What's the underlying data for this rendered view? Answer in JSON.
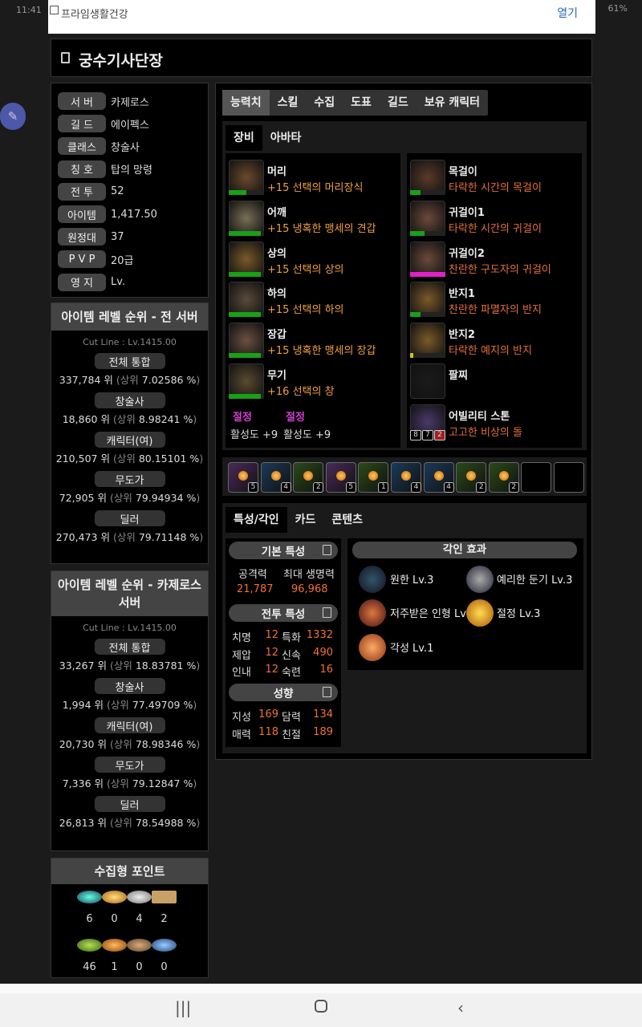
{
  "status": {
    "time": "11:41",
    "battery": "61%"
  },
  "browser": {
    "title": "프라임생활건강",
    "open": "열기"
  },
  "title": "궁수기사단장",
  "info": [
    {
      "k": "서 버",
      "v": "카제로스"
    },
    {
      "k": "길 드",
      "v": "에이펙스"
    },
    {
      "k": "클래스",
      "v": "창술사"
    },
    {
      "k": "칭 호",
      "v": "탑의 망령"
    },
    {
      "k": "전 투",
      "v": "52"
    },
    {
      "k": "아이템",
      "v": "1,417.50"
    },
    {
      "k": "원정대",
      "v": "37"
    },
    {
      "k": "P V P",
      "v": "20급"
    },
    {
      "k": "영 지",
      "v": "Lv."
    }
  ],
  "rank_all": {
    "title": "아이템 레벨 순위 - 전 서버",
    "cut": "Cut Line : Lv.1415.00",
    "items": [
      {
        "label": "전체 통합",
        "rank": "337,784 위",
        "pct": "7.02586 %"
      },
      {
        "label": "창술사",
        "rank": "18,860 위",
        "pct": "8.98241 %"
      },
      {
        "label": "캐릭터(여)",
        "rank": "210,507 위",
        "pct": "80.15101 %"
      },
      {
        "label": "무도가",
        "rank": "72,905 위",
        "pct": "79.94934 %"
      },
      {
        "label": "딜러",
        "rank": "270,473 위",
        "pct": "79.71148 %"
      }
    ]
  },
  "rank_server": {
    "title": "아이템 레벨 순위 - 카제로스 서버",
    "cut": "Cut Line : Lv.1415.00",
    "items": [
      {
        "label": "전체 통합",
        "rank": "33,267 위",
        "pct": "18.83781 %"
      },
      {
        "label": "창술사",
        "rank": "1,994 위",
        "pct": "77.49709 %"
      },
      {
        "label": "캐릭터(여)",
        "rank": "20,730 위",
        "pct": "78.98346 %"
      },
      {
        "label": "무도가",
        "rank": "7,336 위",
        "pct": "79.12847 %"
      },
      {
        "label": "딜러",
        "rank": "26,813 위",
        "pct": "78.54988 %"
      }
    ]
  },
  "rank_prefix": "(상위",
  "rank_suffix": ")",
  "collect": {
    "title": "수집형 포인트",
    "row1": [
      "6",
      "0",
      "4",
      "2"
    ],
    "row2": [
      "46",
      "1",
      "0",
      "0"
    ]
  },
  "tabs": [
    "능력치",
    "스킬",
    "수집",
    "도표",
    "길드",
    "보유 캐릭터"
  ],
  "subtabs": [
    "장비",
    "아바타"
  ],
  "equip_left": [
    {
      "name": "머리",
      "desc": "+15 선택의 머리장식",
      "q": 50
    },
    {
      "name": "어깨",
      "desc": "+15 냉혹한 맹세의 견갑",
      "q": 90
    },
    {
      "name": "상의",
      "desc": "+15 선택의 상의",
      "q": 90
    },
    {
      "name": "하의",
      "desc": "+15 선택의 하의",
      "q": 90
    },
    {
      "name": "장갑",
      "desc": "+15 냉혹한 맹세의 장갑",
      "q": 90
    },
    {
      "name": "무기",
      "desc": "+16 선택의 창",
      "q": 90
    }
  ],
  "equip_right": [
    {
      "name": "목걸이",
      "desc": "타락한 시간의 목걸이",
      "q": 30
    },
    {
      "name": "귀걸이1",
      "desc": "타락한 시간의 귀걸이",
      "q": 40
    },
    {
      "name": "귀걸이2",
      "desc": "찬란한 구도자의 귀걸이",
      "q": 100
    },
    {
      "name": "반지1",
      "desc": "찬란한 파멸자의 반지",
      "q": 30
    },
    {
      "name": "반지2",
      "desc": "타락한 예지의 반지",
      "q": 10
    },
    {
      "name": "팔찌",
      "desc": "",
      "q": 0
    },
    {
      "name": "어빌리티 스톤",
      "desc": "고고한 비상의 돌",
      "q": 0
    }
  ],
  "stone_levels": [
    "8",
    "7",
    "2"
  ],
  "elixir": [
    {
      "label": "절정",
      "sub": "활성도 +9"
    },
    {
      "label": "절정",
      "sub": "활성도 +9"
    }
  ],
  "gems": [
    "5",
    "4",
    "2",
    "5",
    "1",
    "4",
    "4",
    "2",
    "2",
    "",
    ""
  ],
  "lowtabs": [
    "특성/각인",
    "카드",
    "콘텐츠"
  ],
  "basic": {
    "title": "기본 특성",
    "atk_label": "공격력",
    "hp_label": "최대 생명력",
    "atk": "21,787",
    "hp": "96,968"
  },
  "combat": {
    "title": "전투 특성",
    "rows": [
      [
        "치명",
        "12",
        "특화",
        "1332"
      ],
      [
        "제압",
        "12",
        "신속",
        "490"
      ],
      [
        "인내",
        "12",
        "숙련",
        "16"
      ]
    ]
  },
  "tend": {
    "title": "성향",
    "rows": [
      [
        "지성",
        "169",
        "담력",
        "134"
      ],
      [
        "매력",
        "118",
        "친절",
        "189"
      ]
    ]
  },
  "engrave": {
    "title": "각인 효과",
    "items": [
      "원한 Lv.3",
      "예리한 둔기 Lv.3",
      "저주받은 인형 Lv",
      "절정 Lv.3",
      "각성 Lv.1"
    ]
  }
}
